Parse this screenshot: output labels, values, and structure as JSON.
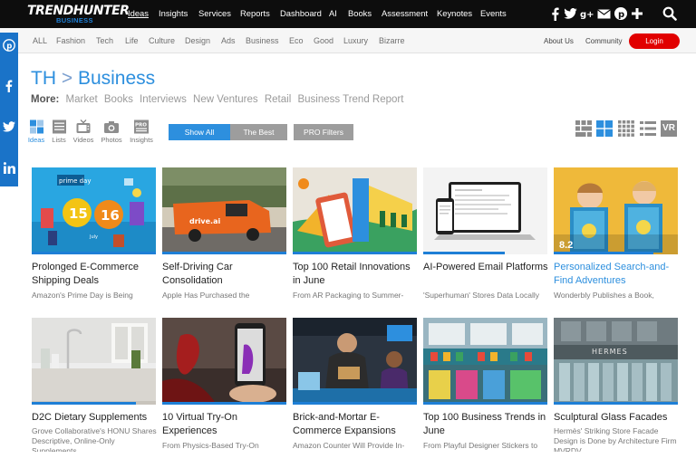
{
  "brand": {
    "name": "TRENDHUNTER",
    "sub": "BUSINESS"
  },
  "topnav": {
    "items": [
      "Ideas",
      "Insights",
      "Services",
      "Reports",
      "Dashboard",
      "AI",
      "Books",
      "Assessment",
      "Keynotes",
      "Events"
    ],
    "active": "Ideas",
    "social_icons": [
      "facebook-icon",
      "twitter-icon",
      "google-plus-icon",
      "email-icon",
      "pinterest-icon",
      "plus-icon"
    ],
    "search_icon": "search-icon"
  },
  "subnav": {
    "categories": [
      "ALL",
      "Fashion",
      "Tech",
      "Life",
      "Culture",
      "Design",
      "Ads",
      "Business",
      "Eco",
      "Good",
      "Luxury",
      "Bizarre"
    ],
    "about": "About Us",
    "community": "Community",
    "login": "Login"
  },
  "side_social": [
    "pinterest-icon",
    "facebook-icon",
    "twitter-icon",
    "linkedin-icon"
  ],
  "page": {
    "crumb_root": "TH",
    "crumb_sep": ">",
    "crumb_current": "Business",
    "more_label": "More:",
    "more_links": [
      "Market",
      "Books",
      "Interviews",
      "New Ventures",
      "Retail",
      "Business Trend Report"
    ]
  },
  "view_tabs": [
    {
      "label": "Ideas",
      "icon": "ideas-grid-icon"
    },
    {
      "label": "Lists",
      "icon": "lists-icon"
    },
    {
      "label": "Videos",
      "icon": "tv-icon"
    },
    {
      "label": "Photos",
      "icon": "camera-icon"
    },
    {
      "label": "Insights",
      "icon": "pro-insights-icon"
    }
  ],
  "filters": {
    "show_all": "Show All",
    "the_best": "The Best",
    "pro_filters": "PRO Filters"
  },
  "layout_icons": [
    "small-grid-icon",
    "medium-grid-icon",
    "dense-grid-icon",
    "list-view-icon",
    "vr-icon"
  ],
  "vr_label": "VR",
  "cards": [
    {
      "title": "Prolonged E-Commerce Shipping Deals",
      "desc": "Amazon's Prime Day is Being",
      "blue": false,
      "score": ""
    },
    {
      "title": "Self-Driving Car Consolidation",
      "desc": "Apple Has Purchased the",
      "blue": false,
      "score": ""
    },
    {
      "title": "Top 100 Retail Innovations in June",
      "desc": "From AR Packaging to Summer-",
      "blue": false,
      "score": ""
    },
    {
      "title": "AI-Powered Email Platforms",
      "desc": "'Superhuman' Stores Data Locally",
      "blue": false,
      "score": ""
    },
    {
      "title": "Personalized Search-and-Find Adventures",
      "desc": "Wonderbly Publishes a Book,",
      "blue": true,
      "score": "8.2"
    },
    {
      "title": "D2C Dietary Supplements",
      "desc": "Grove Collaborative's HONU Shares Descriptive, Online-Only Supplements",
      "blue": false,
      "score": ""
    },
    {
      "title": "10 Virtual Try-On Experiences",
      "desc": "From Physics-Based Try-On",
      "blue": false,
      "score": ""
    },
    {
      "title": "Brick-and-Mortar E-Commerce Expansions",
      "desc": "Amazon Counter Will Provide In-",
      "blue": false,
      "score": ""
    },
    {
      "title": "Top 100 Business Trends in June",
      "desc": "From Playful Designer Stickers to",
      "blue": false,
      "score": ""
    },
    {
      "title": "Sculptural Glass Facades",
      "desc": "Hermès' Striking Store Facade Design is Done by Architecture Firm MVRDV",
      "blue": false,
      "score": ""
    }
  ],
  "card_images": [
    "prime-day-illustration",
    "drive-ai-van-photo",
    "retail-illustration",
    "email-laptop-photo",
    "kids-books-photo",
    "kitchen-supplements-photo",
    "phone-try-on-photo",
    "amazon-counter-photo",
    "colorful-store-photo",
    "hermes-facade-photo"
  ],
  "thumb_text": {
    "prime": "prime day",
    "n1": "15",
    "n2": "16",
    "july": "July",
    "drive": "drive.ai",
    "hermes": "HERMES"
  }
}
